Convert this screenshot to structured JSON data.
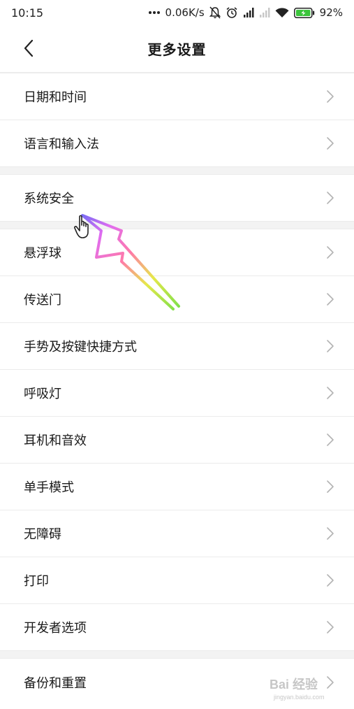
{
  "status_bar": {
    "time": "10:15",
    "net_speed": "0.06K/s",
    "battery": "92%"
  },
  "header": {
    "title": "更多设置"
  },
  "groups": [
    {
      "items": [
        {
          "label": "日期和时间"
        },
        {
          "label": "语言和输入法"
        }
      ]
    },
    {
      "items": [
        {
          "label": "系统安全"
        }
      ]
    },
    {
      "items": [
        {
          "label": "悬浮球"
        },
        {
          "label": "传送门"
        },
        {
          "label": "手势及按键快捷方式"
        },
        {
          "label": "呼吸灯"
        },
        {
          "label": "耳机和音效"
        },
        {
          "label": "单手模式"
        },
        {
          "label": "无障碍"
        },
        {
          "label": "打印"
        },
        {
          "label": "开发者选项"
        }
      ]
    },
    {
      "items": [
        {
          "label": "备份和重置"
        }
      ]
    }
  ],
  "watermark": {
    "brand": "Bai 经验",
    "url": "jingyan.baidu.com"
  },
  "colors": {
    "battery_fill": "#3cc43c",
    "divider": "#ebebeb",
    "group_gap": "#f3f3f3",
    "chevron": "#b3b3b3"
  }
}
